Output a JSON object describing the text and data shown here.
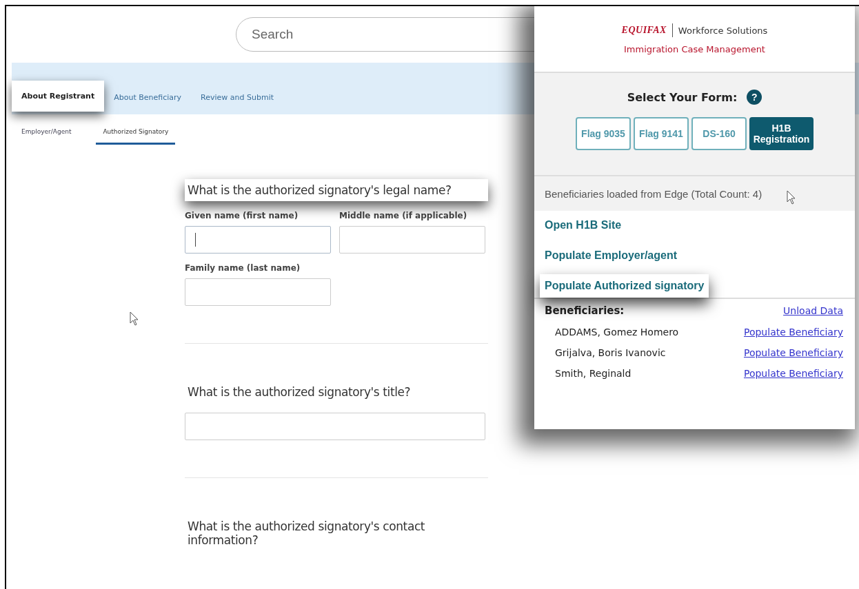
{
  "search": {
    "placeholder": "Search"
  },
  "tabs": [
    {
      "label": "About Registrant",
      "selected": true
    },
    {
      "label": "About Beneficiary",
      "selected": false
    },
    {
      "label": "Review and Submit",
      "selected": false
    }
  ],
  "subtabs": [
    {
      "label": "Employer/Agent",
      "selected": false
    },
    {
      "label": "Authorized Signatory",
      "selected": true
    }
  ],
  "questions": [
    {
      "title": "What is the authorized signatory's legal name?",
      "highlighted": true,
      "fields": [
        {
          "label": "Given name (first name)",
          "focused": true
        },
        {
          "label": "Middle name (if applicable)",
          "focused": false
        },
        {
          "label": "Family name (last name)",
          "focused": false
        }
      ]
    },
    {
      "title": "What is the authorized signatory's title?",
      "highlighted": false,
      "fields": [
        {
          "focused": false
        }
      ]
    },
    {
      "title": "What is the authorized signatory's contact information?",
      "highlighted": false
    }
  ],
  "panel": {
    "brand": "EQUIFAX",
    "division": "Workforce Solutions",
    "product": "Immigration Case Management",
    "form_prompt": "Select Your Form:",
    "help": "?",
    "forms": [
      {
        "label": "Flag 9035",
        "selected": false
      },
      {
        "label": "Flag 9141",
        "selected": false
      },
      {
        "label": "DS-160",
        "selected": false
      },
      {
        "label": "H1B Registration",
        "selected": true
      }
    ],
    "status": "Beneficiaries loaded from Edge (Total Count: 4)",
    "actions": [
      {
        "label": "Open H1B Site",
        "highlighted": false
      },
      {
        "label": "Populate Employer/agent",
        "highlighted": false
      },
      {
        "label": "Populate Authorized signatory",
        "highlighted": true
      }
    ],
    "beneficiaries_heading": "Beneficiaries:",
    "unload": "Unload Data",
    "beneficiaries": [
      {
        "name": "ADDAMS, Gomez Homero",
        "action": "Populate Beneficiary"
      },
      {
        "name": "Grijalva, Boris Ivanovic",
        "action": "Populate Beneficiary"
      },
      {
        "name": "Smith, Reginald",
        "action": "Populate Beneficiary"
      }
    ]
  }
}
